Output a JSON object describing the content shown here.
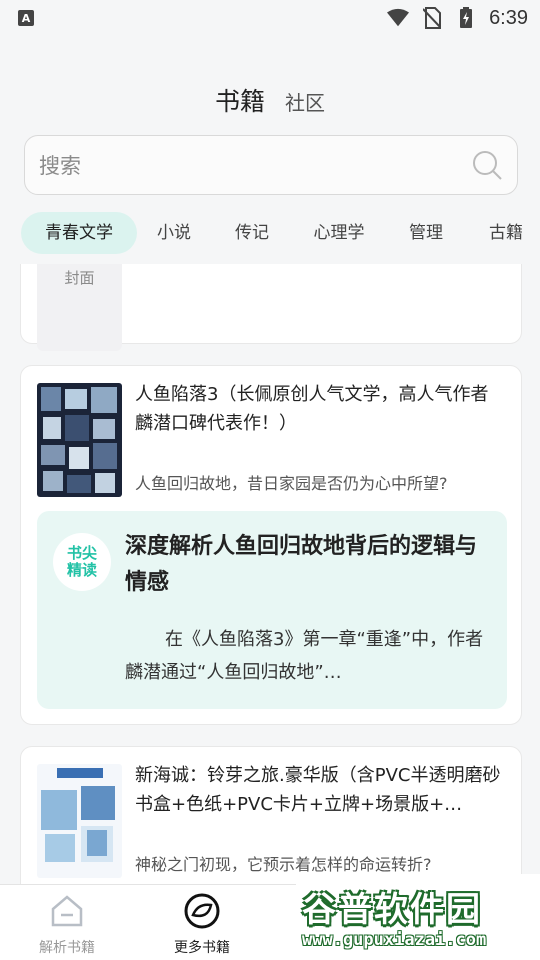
{
  "status_bar": {
    "left_glyph": "A",
    "time": "6:39"
  },
  "top_tabs": {
    "active": "书籍",
    "other": "社区"
  },
  "search": {
    "placeholder": "搜索"
  },
  "categories": [
    "青春文学",
    "小说",
    "传记",
    "心理学",
    "管理",
    "古籍"
  ],
  "cards": {
    "partial": {
      "cover_text": "封面"
    },
    "book1": {
      "title": "人鱼陷落3（长佩原创人气文学，高人气作者麟潜口碑代表作！）",
      "subtitle": "人鱼回归故地，昔日家园是否仍为心中所望?",
      "deep_badge_line1": "书尖",
      "deep_badge_line2": "精读",
      "deep_title": "深度解析人鱼回归故地背后的逻辑与情感",
      "deep_body": "在《人鱼陷落3》第一章“重逢”中，作者麟潜通过“人鱼回归故地”…"
    },
    "book2": {
      "title": "新海诚：铃芽之旅.豪华版（含PVC半透明磨砂书盒+色纸+PVC卡片+立牌+场景版+…",
      "subtitle": "神秘之门初现，它预示着怎样的命运转折?"
    }
  },
  "bottom_nav": {
    "item1": "解析书籍",
    "item2": "更多书籍"
  },
  "watermark": {
    "brand": "谷普软件园",
    "url": "www.gupuxiazai.com"
  }
}
